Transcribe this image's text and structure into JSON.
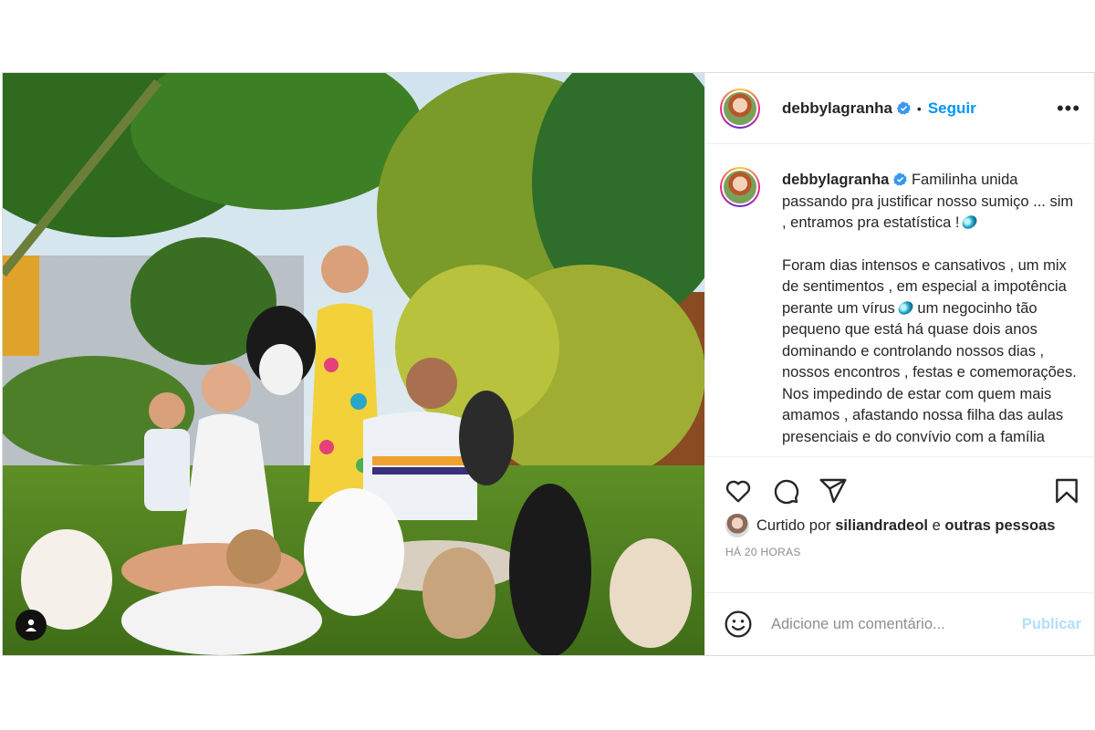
{
  "post": {
    "username": "debbylagranha",
    "follow_label": "Seguir",
    "separator": "•",
    "more_label": "•••",
    "caption_para1": "Familinha unida passando pra justificar nosso sumiço ... sim , entramos pra estatística !",
    "caption_para2_a": "Foram dias intensos e cansativos , um mix de sentimentos , em especial a impotência perante um vírus",
    "caption_para2_b": "um negocinho tão pequeno que está há quase dois anos dominando e controlando nossos dias , nossos encontros , festas e comemorações. Nos impedindo de estar com quem mais amamos , afastando nossa filha das aulas presenciais e do convívio com a família",
    "likes_prefix": "Curtido por",
    "likes_user": "siliandradeol",
    "likes_joiner": "e",
    "likes_others": "outras pessoas",
    "timestamp": "HÁ 20 HORAS",
    "comment_placeholder": "Adicione um comentário...",
    "publish_label": "Publicar"
  },
  "icons": {
    "verified": "verified-badge-icon",
    "like": "heart-icon",
    "comment": "comment-bubble-icon",
    "share": "paper-plane-icon",
    "save": "bookmark-icon",
    "emoji": "smiley-icon",
    "tag": "user-tag-icon",
    "caption_emoji": "gem-emoji"
  },
  "colors": {
    "accent": "#0095f6",
    "publish_disabled": "#b2dffc",
    "muted": "#8e8e8e",
    "text": "#262626"
  }
}
